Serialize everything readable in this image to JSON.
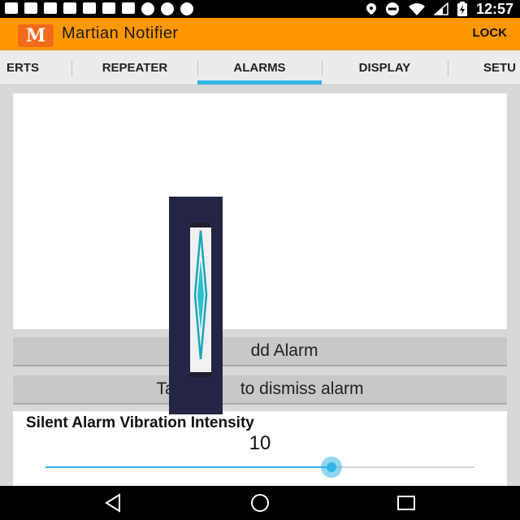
{
  "status_bar": {
    "time": "12:57",
    "left_icons": [
      "keyboard-icon",
      "facebook-icon",
      "facebook-icon",
      "keyhole-icon",
      "facebook-icon",
      "image-icon",
      "image-icon",
      "dollar-icon",
      "dollar-icon",
      "dollar-icon"
    ],
    "right_icons": [
      "location-icon",
      "do-not-disturb-icon",
      "wifi-icon",
      "signal-icon",
      "battery-charging-icon"
    ]
  },
  "app_bar": {
    "logo_text": "M",
    "title": "Martian Notifier",
    "lock_label": "LOCK"
  },
  "tabs": [
    {
      "label": "ERTS",
      "selected": false
    },
    {
      "label": "REPEATER",
      "selected": false
    },
    {
      "label": "ALARMS",
      "selected": true
    },
    {
      "label": "DISPLAY",
      "selected": false
    },
    {
      "label": "SETU",
      "selected": false
    }
  ],
  "buttons": {
    "add_alarm": "dd Alarm",
    "dismiss_prefix": "Tap h",
    "dismiss_suffix": "to dismiss alarm"
  },
  "slider": {
    "title": "Silent Alarm Vibration Intensity",
    "value": "10",
    "fraction": 0.667
  },
  "colors": {
    "accent": "#33b5e5",
    "app_bar": "#ff9800"
  }
}
